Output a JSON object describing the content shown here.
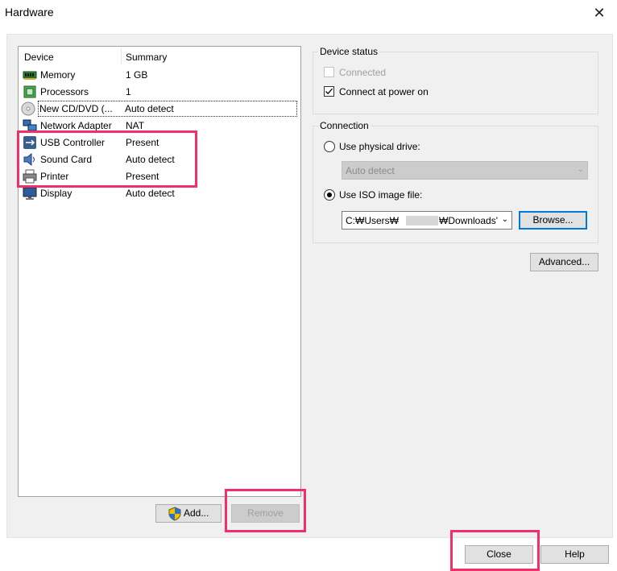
{
  "window": {
    "title": "Hardware",
    "close_glyph": "✕"
  },
  "device_list": {
    "headers": {
      "device": "Device",
      "summary": "Summary"
    },
    "rows": [
      {
        "name": "Memory",
        "summary": "1 GB",
        "icon": "memory-icon"
      },
      {
        "name": "Processors",
        "summary": "1",
        "icon": "processor-icon"
      },
      {
        "name": "New CD/DVD (...",
        "summary": "Auto detect",
        "icon": "cd-dvd-icon"
      },
      {
        "name": "Network Adapter",
        "summary": "NAT",
        "icon": "network-adapter-icon"
      },
      {
        "name": "USB Controller",
        "summary": "Present",
        "icon": "usb-controller-icon"
      },
      {
        "name": "Sound Card",
        "summary": "Auto detect",
        "icon": "sound-card-icon"
      },
      {
        "name": "Printer",
        "summary": "Present",
        "icon": "printer-icon"
      },
      {
        "name": "Display",
        "summary": "Auto detect",
        "icon": "display-icon"
      }
    ],
    "selected_index": 2
  },
  "buttons": {
    "add": "Add...",
    "remove": "Remove",
    "close": "Close",
    "help": "Help",
    "browse": "Browse...",
    "advanced": "Advanced..."
  },
  "device_status": {
    "title": "Device status",
    "connected_label": "Connected",
    "connected_checked": false,
    "power_on_label": "Connect at power on",
    "power_on_checked": true
  },
  "connection": {
    "title": "Connection",
    "physical_label": "Use physical drive:",
    "physical_value": "Auto detect",
    "iso_label": "Use ISO image file:",
    "iso_value_prefix": "C:₩Users₩",
    "iso_value_suffix": "₩Downloads'",
    "selected": "iso"
  },
  "colors": {
    "highlight": "#f0306a",
    "accent": "#0078d7",
    "disabled_text": "#a0a0a0"
  }
}
